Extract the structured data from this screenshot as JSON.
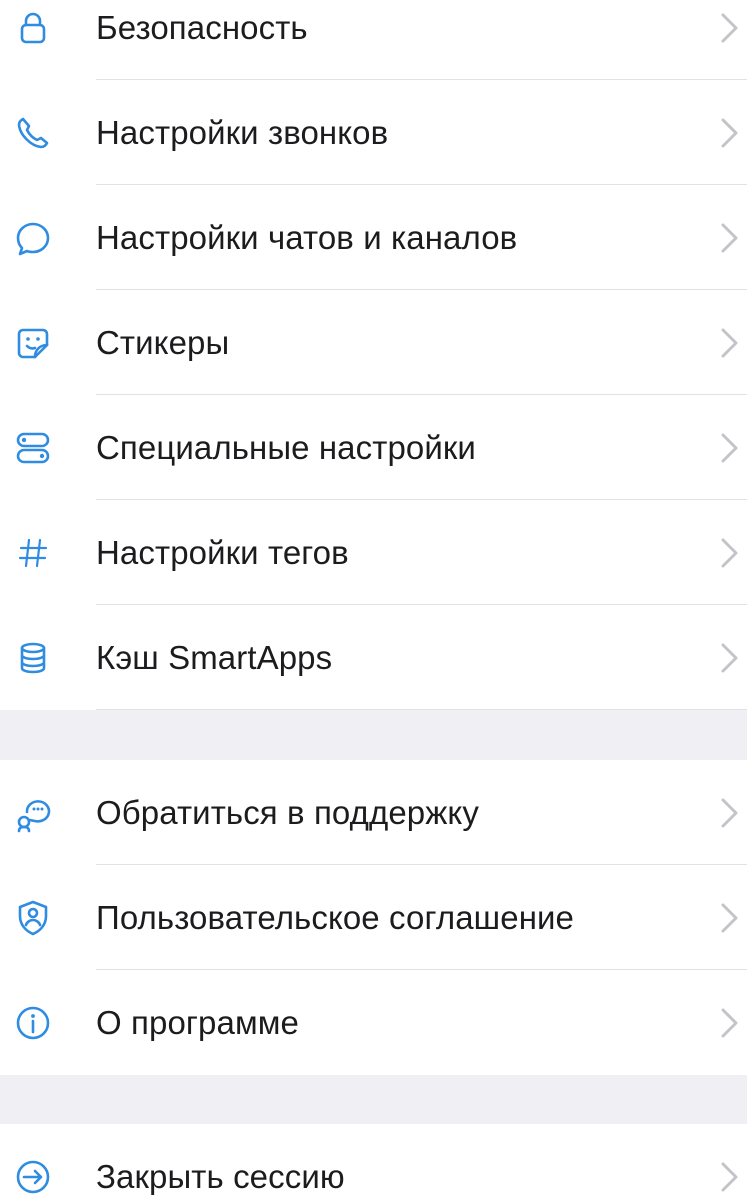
{
  "colors": {
    "accent": "#2f8ce0",
    "background": "#f0f0f4",
    "row_background": "#ffffff",
    "text": "#1c1c1e",
    "chevron": "#c4c4c8",
    "separator": "#e2e2e6"
  },
  "group1": {
    "items": [
      {
        "label": "Безопасность",
        "icon": "lock-icon"
      },
      {
        "label": "Настройки звонков",
        "icon": "phone-icon"
      },
      {
        "label": "Настройки чатов и каналов",
        "icon": "chat-bubble-icon"
      },
      {
        "label": "Стикеры",
        "icon": "sticker-icon"
      },
      {
        "label": "Специальные настройки",
        "icon": "toggles-icon"
      },
      {
        "label": "Настройки тегов",
        "icon": "hashtag-icon"
      },
      {
        "label": "Кэш SmartApps",
        "icon": "database-icon"
      }
    ]
  },
  "group2": {
    "items": [
      {
        "label": "Обратиться в поддержку",
        "icon": "support-chat-icon"
      },
      {
        "label": "Пользовательское соглашение",
        "icon": "shield-user-icon"
      },
      {
        "label": "О программе",
        "icon": "info-icon"
      }
    ]
  },
  "group3": {
    "items": [
      {
        "label": "Закрыть сессию",
        "icon": "logout-icon"
      }
    ]
  }
}
